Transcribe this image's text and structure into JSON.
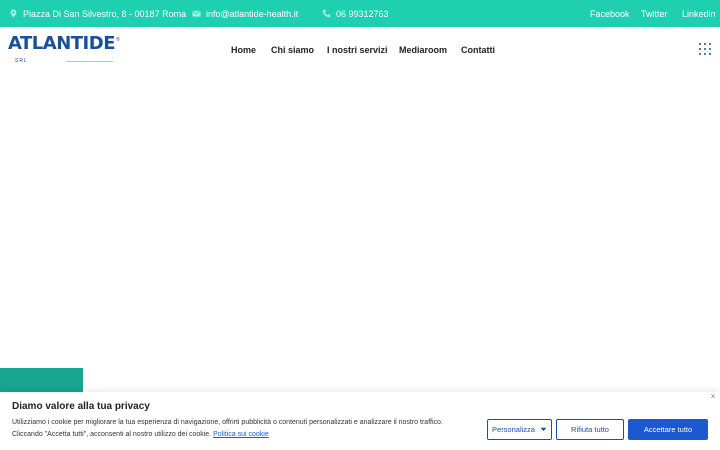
{
  "topbar": {
    "address": "Piazza Di San Silvestro, 8 - 00187 Roma",
    "email": "info@atlantide-health.it",
    "phone": "06 99312763",
    "social": [
      "Facebook",
      "Twitter",
      "Linkedin"
    ],
    "icons": [
      "map-pin-icon",
      "mail-icon",
      "phone-icon"
    ]
  },
  "logo": {
    "text": "ATLANTIDE",
    "suffix": "SRL",
    "registered": "®"
  },
  "nav": {
    "items": [
      "Home",
      "Chi siamo",
      "I nostri servizi",
      "Mediaroom",
      "Contatti"
    ]
  },
  "cookie": {
    "title": "Diamo valore alla tua privacy",
    "line1": "Utilizziamo i cookie per migliorare la tua esperienza di navigazione, offrirti pubblicità o contenuti personalizzati e analizzare il nostro traffico.",
    "line2": "Cliccando \"Accetta tutti\", acconsenti al nostro utilizzo dei cookie.",
    "policy_link": "Politica sui cookie",
    "close": "×",
    "customize_label": "Personalizza",
    "reject_label": "Rifiuta tutto",
    "accept_label": "Accettare tutto"
  },
  "colors": {
    "topbar": "#1ed0b0",
    "brand": "#1c4f99",
    "accent_block": "#18a592",
    "button": "#1c58d0"
  }
}
